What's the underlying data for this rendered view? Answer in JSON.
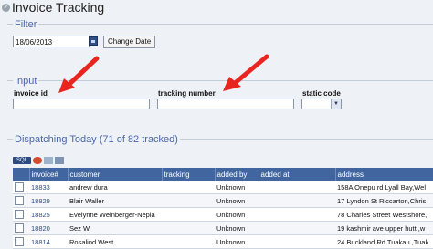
{
  "app": {
    "title": "Invoice Tracking"
  },
  "filter": {
    "legend": "Filter",
    "date_value": "18/06/2013",
    "change_date_label": "Change Date"
  },
  "input": {
    "legend": "Input",
    "invoice_id_label": "invoice id",
    "tracking_number_label": "tracking number",
    "static_code_label": "static code"
  },
  "dispatch": {
    "legend": "Dispatching Today (71 of 82 tracked)",
    "sql_label": "SQL"
  },
  "table": {
    "headers": [
      "invoice#",
      "customer",
      "tracking",
      "added by",
      "added at",
      "address"
    ],
    "rows": [
      {
        "invoice": "18833",
        "customer": "andrew dura",
        "tracking": "",
        "added_by": "Unknown",
        "added_at": "",
        "address": "158A Onepu rd Lyall Bay,Wel"
      },
      {
        "invoice": "18829",
        "customer": "Blair Waller",
        "tracking": "",
        "added_by": "Unknown",
        "added_at": "",
        "address": "17 Lyndon St Riccarton,Chris"
      },
      {
        "invoice": "18825",
        "customer": "Evelynne Weinberger-Nepia",
        "tracking": "",
        "added_by": "Unknown",
        "added_at": "",
        "address": "78 Charles Street Westshore,"
      },
      {
        "invoice": "18820",
        "customer": "Sez W",
        "tracking": "",
        "added_by": "Unknown",
        "added_at": "",
        "address": "19 kashmir ave upper hutt ,w"
      },
      {
        "invoice": "18814",
        "customer": "Rosalind West",
        "tracking": "",
        "added_by": "Unknown",
        "added_at": "",
        "address": "24 Buckland Rd Tuakau ,Tuak"
      }
    ]
  },
  "colors": {
    "accent": "#41669f",
    "arrow": "#e8261f",
    "legend": "#4a67a8"
  }
}
